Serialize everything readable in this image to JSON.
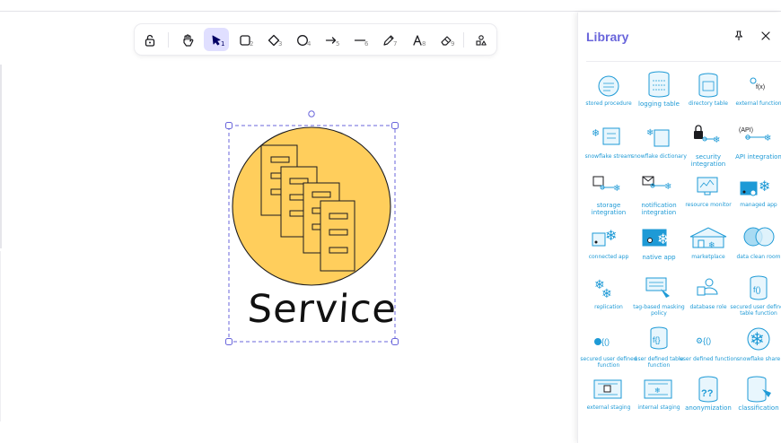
{
  "toolbar": {
    "tools": [
      {
        "name": "lock",
        "key": ""
      },
      {
        "name": "hand",
        "key": ""
      },
      {
        "name": "selection",
        "key": "1"
      },
      {
        "name": "rectangle",
        "key": "2"
      },
      {
        "name": "diamond",
        "key": "3"
      },
      {
        "name": "ellipse",
        "key": "4"
      },
      {
        "name": "arrow",
        "key": "5"
      },
      {
        "name": "line",
        "key": "6"
      },
      {
        "name": "draw",
        "key": "7"
      },
      {
        "name": "text",
        "key": "8"
      },
      {
        "name": "eraser",
        "key": "9"
      },
      {
        "name": "more-shapes",
        "key": ""
      }
    ],
    "active_tool": "selection"
  },
  "canvas": {
    "label": "Service",
    "fill_color": "#ffce5c",
    "selection_color": "#6965db"
  },
  "library": {
    "title": "Library",
    "items": [
      {
        "caption": "stored procedure"
      },
      {
        "caption": "logging table"
      },
      {
        "caption": "directory table"
      },
      {
        "caption": "external function"
      },
      {
        "caption": "snowflake stream"
      },
      {
        "caption": "snowflake dictionary"
      },
      {
        "caption": "security integration"
      },
      {
        "caption": "API integration",
        "badge": "(API)"
      },
      {
        "caption": "storage integration"
      },
      {
        "caption": "notification integration"
      },
      {
        "caption": "resource monitor"
      },
      {
        "caption": "managed app"
      },
      {
        "caption": "connected app"
      },
      {
        "caption": "native app"
      },
      {
        "caption": "marketplace"
      },
      {
        "caption": "data clean room"
      },
      {
        "caption": "replication"
      },
      {
        "caption": "tag-based masking policy"
      },
      {
        "caption": "database role"
      },
      {
        "caption": "secured user defined table function"
      },
      {
        "caption": "secured user defined function"
      },
      {
        "caption": "user defined table function"
      },
      {
        "caption": "user defined function"
      },
      {
        "caption": "snowflake share"
      },
      {
        "caption": "external staging"
      },
      {
        "caption": "internal staging"
      },
      {
        "caption": "anonymization",
        "badge": "??"
      },
      {
        "caption": "classification"
      }
    ],
    "accent_color": "#1e9ad6"
  }
}
